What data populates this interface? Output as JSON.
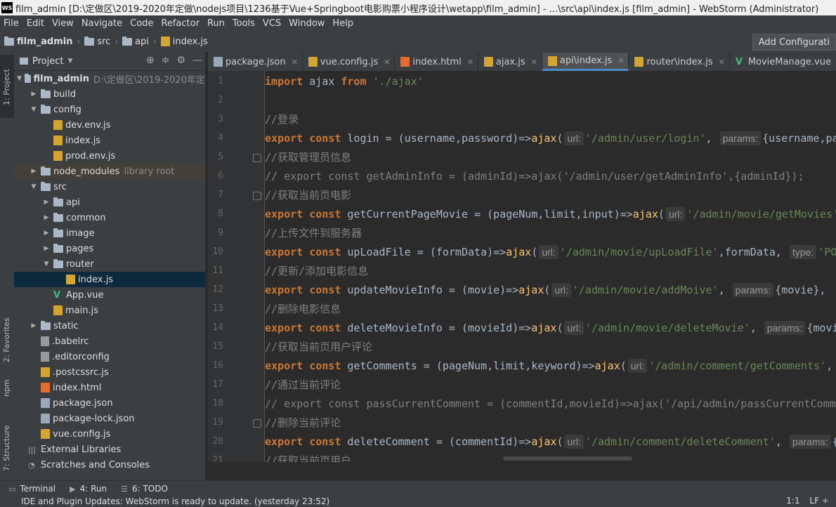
{
  "window": {
    "title": "film_admin [D:\\定做区\\2019-2020年定做\\nodejs项目\\1236基于Vue+Springboot电影购票小程序设计\\wetapp\\film_admin] - ...\\src\\api\\index.js [film_admin] - WebStorm (Administrator)",
    "logo": "WS"
  },
  "menu": [
    "File",
    "Edit",
    "View",
    "Navigate",
    "Code",
    "Refactor",
    "Run",
    "Tools",
    "VCS",
    "Window",
    "Help"
  ],
  "breadcrumb": {
    "items": [
      "film_admin",
      "src",
      "api",
      "index.js"
    ],
    "add_config": "Add Configurati"
  },
  "left_strip": {
    "project": "1: Project",
    "favorites": "2: Favorites",
    "npm": "npm",
    "structure": "7: Structure"
  },
  "project_panel": {
    "title": "Project",
    "tree": [
      {
        "label": "film_admin",
        "hint": "D:\\定做区\\2019-2020年定",
        "type": "folder",
        "depth": 0,
        "expanded": true,
        "bold": true
      },
      {
        "label": "build",
        "type": "folder",
        "depth": 1,
        "expanded": false
      },
      {
        "label": "config",
        "type": "folder",
        "depth": 1,
        "expanded": true
      },
      {
        "label": "dev.env.js",
        "type": "js",
        "depth": 2
      },
      {
        "label": "index.js",
        "type": "js",
        "depth": 2
      },
      {
        "label": "prod.env.js",
        "type": "js",
        "depth": 2
      },
      {
        "label": "node_modules",
        "hint": "library root",
        "type": "folder",
        "depth": 1,
        "expanded": false,
        "libroot": true
      },
      {
        "label": "src",
        "type": "folder",
        "depth": 1,
        "expanded": true
      },
      {
        "label": "api",
        "type": "folder",
        "depth": 2,
        "expanded": false
      },
      {
        "label": "common",
        "type": "folder",
        "depth": 2,
        "expanded": false
      },
      {
        "label": "image",
        "type": "folder",
        "depth": 2,
        "expanded": false
      },
      {
        "label": "pages",
        "type": "folder",
        "depth": 2,
        "expanded": false
      },
      {
        "label": "router",
        "type": "folder",
        "depth": 2,
        "expanded": true
      },
      {
        "label": "index.js",
        "type": "js",
        "depth": 3,
        "selected": true
      },
      {
        "label": "App.vue",
        "type": "vue",
        "depth": 2
      },
      {
        "label": "main.js",
        "type": "js",
        "depth": 2
      },
      {
        "label": "static",
        "type": "folder",
        "depth": 1,
        "expanded": false
      },
      {
        "label": ".babelrc",
        "type": "file",
        "depth": 1
      },
      {
        "label": ".editorconfig",
        "type": "file",
        "depth": 1
      },
      {
        "label": ".postcssrc.js",
        "type": "js",
        "depth": 1
      },
      {
        "label": "index.html",
        "type": "html",
        "depth": 1
      },
      {
        "label": "package.json",
        "type": "json",
        "depth": 1
      },
      {
        "label": "package-lock.json",
        "type": "json",
        "depth": 1
      },
      {
        "label": "vue.config.js",
        "type": "js",
        "depth": 1
      },
      {
        "label": "External Libraries",
        "type": "lib",
        "depth": 0
      },
      {
        "label": "Scratches and Consoles",
        "type": "scratch",
        "depth": 0
      }
    ]
  },
  "tabs": [
    {
      "label": "package.json",
      "type": "json"
    },
    {
      "label": "vue.config.js",
      "type": "js"
    },
    {
      "label": "index.html",
      "type": "html"
    },
    {
      "label": "ajax.js",
      "type": "js"
    },
    {
      "label": "api\\index.js",
      "type": "js",
      "active": true
    },
    {
      "label": "router\\index.js",
      "type": "js"
    },
    {
      "label": "MovieManage.vue",
      "type": "vue"
    }
  ],
  "editor": {
    "line_numbers": [
      "1",
      "2",
      "3",
      "4",
      "5",
      "6",
      "7",
      "8",
      "9",
      "10",
      "11",
      "12",
      "13",
      "14",
      "15",
      "16",
      "17",
      "18",
      "19",
      "20",
      "21"
    ],
    "lines": [
      [
        {
          "t": "import",
          "c": "kw"
        },
        {
          "t": " ajax "
        },
        {
          "t": "from",
          "c": "kw"
        },
        {
          "t": " "
        },
        {
          "t": "'./ajax'",
          "c": "str"
        }
      ],
      [],
      [
        {
          "t": "//登录",
          "c": "cm"
        }
      ],
      [
        {
          "t": "export const",
          "c": "kw"
        },
        {
          "t": " login = (username,password)=>"
        },
        {
          "t": "ajax",
          "c": "fn"
        },
        {
          "t": "("
        },
        {
          "t": "url:",
          "h": 1
        },
        {
          "t": "'/admin/user/login'",
          "c": "str"
        },
        {
          "t": ", "
        },
        {
          "t": "params:",
          "h": 1
        },
        {
          "t": "{username,password},"
        }
      ],
      [
        {
          "t": "//获取管理员信息",
          "c": "cm"
        }
      ],
      [
        {
          "t": "// export const getAdminInfo = (adminId)=>ajax('/admin/user/getAdminInfo',{adminId});",
          "c": "cm"
        }
      ],
      [
        {
          "t": "//获取当前页电影",
          "c": "cm"
        }
      ],
      [
        {
          "t": "export const",
          "c": "kw"
        },
        {
          "t": " getCurrentPageMovie = (pageNum,limit,input)=>"
        },
        {
          "t": "ajax",
          "c": "fn"
        },
        {
          "t": "("
        },
        {
          "t": "url:",
          "h": 1
        },
        {
          "t": "'/admin/movie/getMovies'",
          "c": "str"
        }
      ],
      [
        {
          "t": "//上传文件到服务器",
          "c": "cm"
        }
      ],
      [
        {
          "t": "export const",
          "c": "kw"
        },
        {
          "t": " upLoadFile = (formData)=>"
        },
        {
          "t": "ajax",
          "c": "fn"
        },
        {
          "t": "("
        },
        {
          "t": "url:",
          "h": 1
        },
        {
          "t": "'/admin/movie/upLoadFile'",
          "c": "str"
        },
        {
          "t": ",formData, "
        },
        {
          "t": "type:",
          "h": 1
        },
        {
          "t": "'POST'",
          "c": "str"
        }
      ],
      [
        {
          "t": "//更新/添加电影信息",
          "c": "cm"
        }
      ],
      [
        {
          "t": "export const",
          "c": "kw"
        },
        {
          "t": " updateMovieInfo = (movie)=>"
        },
        {
          "t": "ajax",
          "c": "fn"
        },
        {
          "t": "("
        },
        {
          "t": "url:",
          "h": 1
        },
        {
          "t": "'/admin/movie/addMoive'",
          "c": "str"
        },
        {
          "t": ", "
        },
        {
          "t": "params:",
          "h": 1
        },
        {
          "t": "{movie},"
        }
      ],
      [
        {
          "t": "//删除电影信息",
          "c": "cm"
        }
      ],
      [
        {
          "t": "export const",
          "c": "kw"
        },
        {
          "t": " deleteMovieInfo = (movieId)=>"
        },
        {
          "t": "ajax",
          "c": "fn"
        },
        {
          "t": "("
        },
        {
          "t": "url:",
          "h": 1
        },
        {
          "t": "'/admin/movie/deleteMovie'",
          "c": "str"
        },
        {
          "t": ", "
        },
        {
          "t": "params:",
          "h": 1
        },
        {
          "t": "{movieId},"
        }
      ],
      [
        {
          "t": "//获取当前页用户评论",
          "c": "cm"
        }
      ],
      [
        {
          "t": "export const",
          "c": "kw"
        },
        {
          "t": " getComments = (pageNum,limit,keyword)=>"
        },
        {
          "t": "ajax",
          "c": "fn"
        },
        {
          "t": "("
        },
        {
          "t": "url:",
          "h": 1
        },
        {
          "t": "'/admin/comment/getComments'",
          "c": "str"
        },
        {
          "t": ", "
        }
      ],
      [
        {
          "t": "//通过当前评论",
          "c": "cm"
        }
      ],
      [
        {
          "t": "// export const passCurrentComment = (commentId,movieId)=>ajax('/api/admin/passCurrentComment'",
          "c": "cm"
        }
      ],
      [
        {
          "t": "//删除当前评论",
          "c": "cm"
        }
      ],
      [
        {
          "t": "export const",
          "c": "kw"
        },
        {
          "t": " deleteComment = (commentId)=>"
        },
        {
          "t": "ajax",
          "c": "fn"
        },
        {
          "t": "("
        },
        {
          "t": "url:",
          "h": 1
        },
        {
          "t": "'/admin/comment/deleteComment'",
          "c": "str"
        },
        {
          "t": ", "
        },
        {
          "t": "params:",
          "h": 1
        },
        {
          "t": "{commentId},"
        }
      ],
      [
        {
          "t": "//获取当前页用户",
          "c": "cm"
        }
      ]
    ]
  },
  "bottom_tools": [
    {
      "label": "Terminal",
      "icon": "terminal-icon"
    },
    {
      "label": "4: Run",
      "icon": "run-icon"
    },
    {
      "label": "6: TODO",
      "icon": "todo-icon"
    }
  ],
  "status": {
    "message": "IDE and Plugin Updates: WebStorm is ready to update. (yesterday 23:52)",
    "position": "1:1",
    "line_sep": "LF ÷"
  }
}
